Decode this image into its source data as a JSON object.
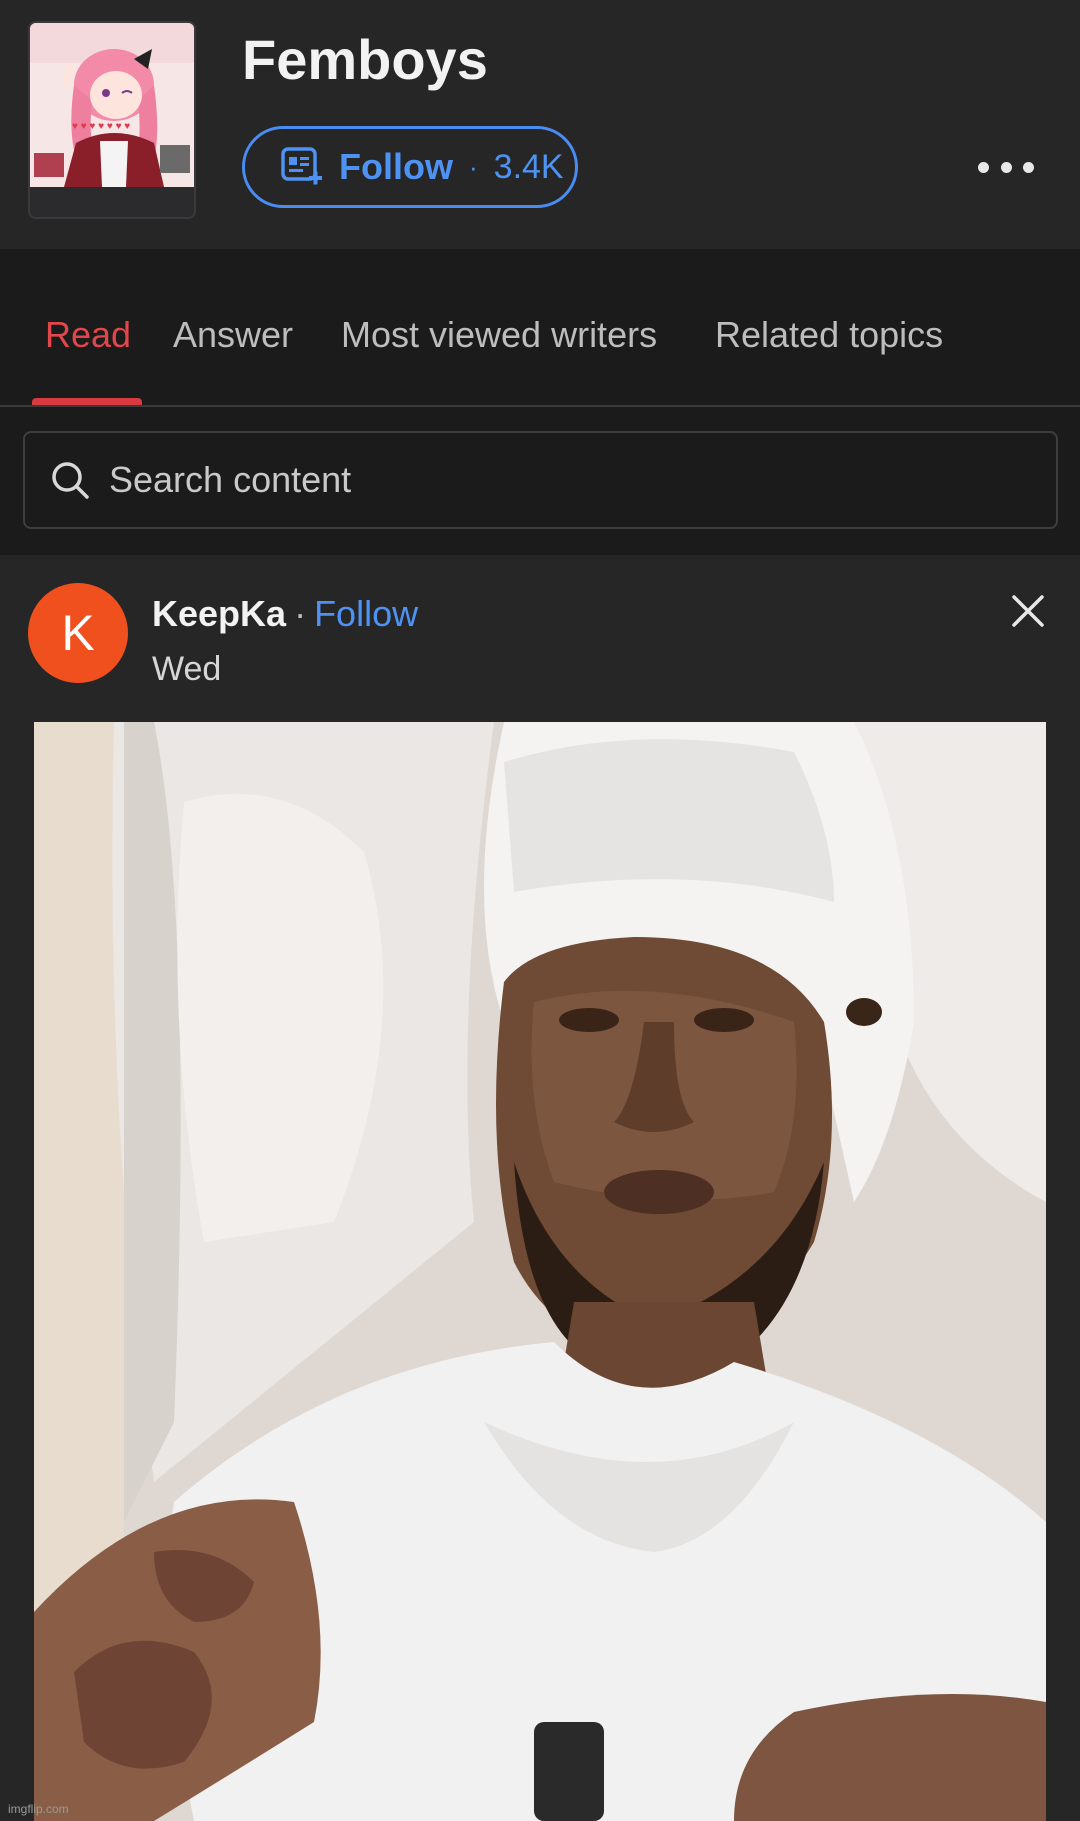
{
  "topic": {
    "title": "Femboys",
    "follow_label": "Follow",
    "follow_separator": "·",
    "follower_count": "3.4K",
    "image_icon": "anime-topic-image"
  },
  "tabs": [
    {
      "label": "Read",
      "active": true
    },
    {
      "label": "Answer",
      "active": false
    },
    {
      "label": "Most viewed writers",
      "active": false
    },
    {
      "label": "Related topics",
      "active": false
    }
  ],
  "search": {
    "placeholder": "Search content",
    "icon": "search-icon"
  },
  "post": {
    "avatar_letter": "K",
    "author": "KeepKa",
    "separator": "·",
    "follow_label": "Follow",
    "date": "Wed",
    "image_icon": "photo-man-white-shirt"
  },
  "watermark": "imgflip.com",
  "colors": {
    "accent_blue": "#4e93f3",
    "active_tab_red": "#e0464a",
    "avatar_orange": "#f0501d",
    "background": "#1b1b1c",
    "panel": "#262627"
  }
}
